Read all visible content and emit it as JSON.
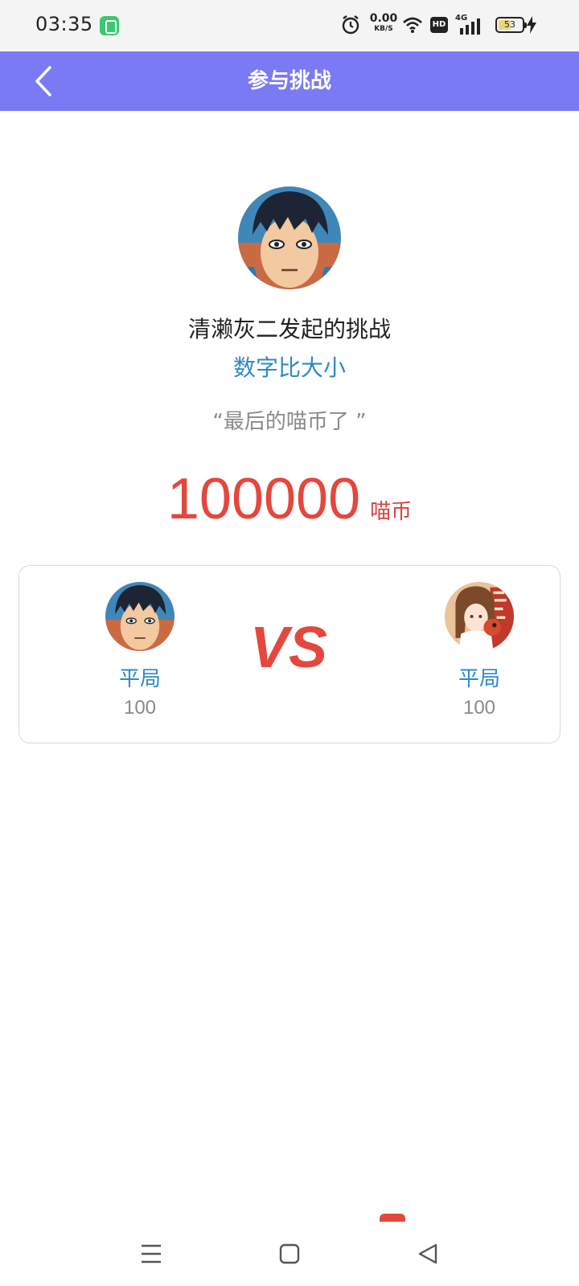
{
  "status_bar": {
    "time": "03:35",
    "net_speed_value": "0.00",
    "net_speed_unit": "KB/S",
    "hd_label": "HD",
    "network_label": "4G",
    "battery_level": "53",
    "battery_fraction": 0.53,
    "icons": [
      "app-badge-icon",
      "alarm-icon",
      "wifi-icon",
      "hd-icon",
      "signal-4g-icon",
      "battery-icon",
      "charging-icon"
    ]
  },
  "header": {
    "title": "参与挑战",
    "back_icon": "chevron-left-icon",
    "background_color": "#7a7af4"
  },
  "challenge": {
    "title": "清濑灰二发起的挑战",
    "game_name": "数字比大小",
    "quote": "“最后的喵币了 ”",
    "amount": "100000",
    "unit": "喵币"
  },
  "match": {
    "left_player": {
      "result": "平局",
      "score": "100"
    },
    "vs_label": "VS",
    "right_player": {
      "result": "平局",
      "score": "100"
    }
  },
  "nav_bar": {
    "icons": [
      "menu-icon",
      "home-icon",
      "back-triangle-icon"
    ]
  },
  "colors": {
    "accent_blue": "#2f8ac4",
    "amount_red": "#e4473e",
    "header_purple": "#7a7af4"
  }
}
